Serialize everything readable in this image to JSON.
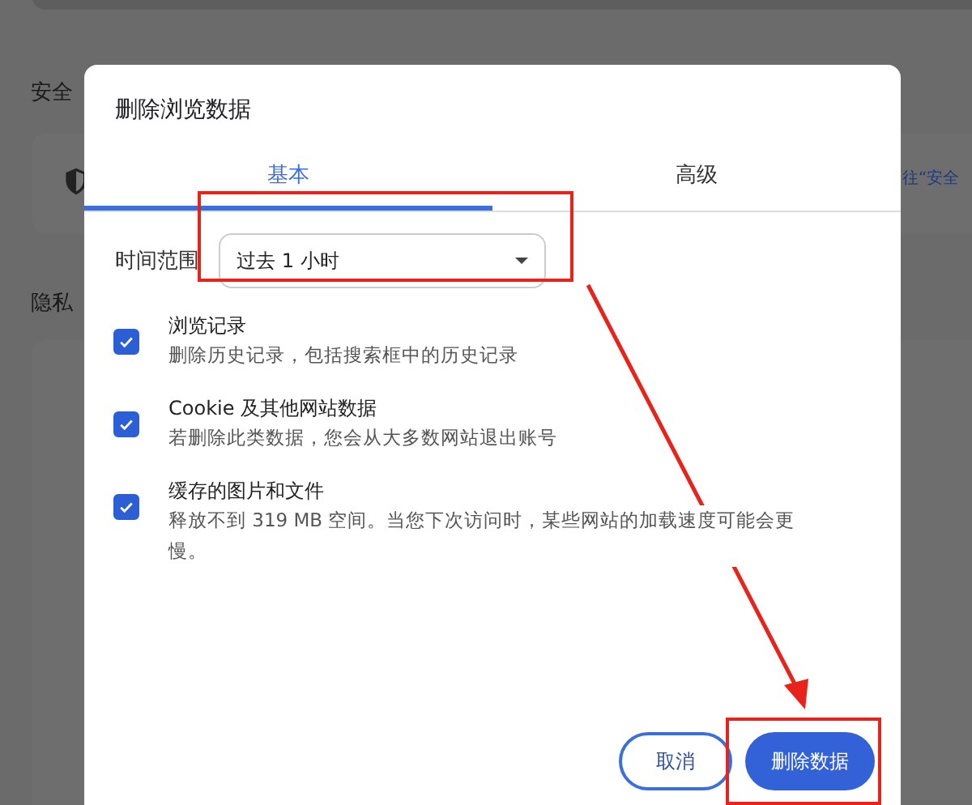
{
  "background": {
    "section_1": "安全",
    "link_fragment": "往“安全",
    "section_2": "隐私"
  },
  "dialog": {
    "title": "删除浏览数据",
    "tabs": [
      {
        "label": "基本",
        "selected": true
      },
      {
        "label": "高级",
        "selected": false
      }
    ],
    "time_range": {
      "label": "时间范围",
      "value": "过去 1 小时"
    },
    "options": [
      {
        "title": "浏览记录",
        "description": "删除历史记录，包括搜索框中的历史记录",
        "checked": true
      },
      {
        "title": "Cookie 及其他网站数据",
        "description": "若删除此类数据，您会从大多数网站退出账号",
        "checked": true
      },
      {
        "title": "缓存的图片和文件",
        "description": "释放不到 319 MB 空间。当您下次访问时，某些网站的加载速度可能会更慢。",
        "checked": true
      }
    ],
    "buttons": [
      {
        "label": "取消",
        "kind": "secondary"
      },
      {
        "label": "删除数据",
        "kind": "primary"
      }
    ]
  }
}
